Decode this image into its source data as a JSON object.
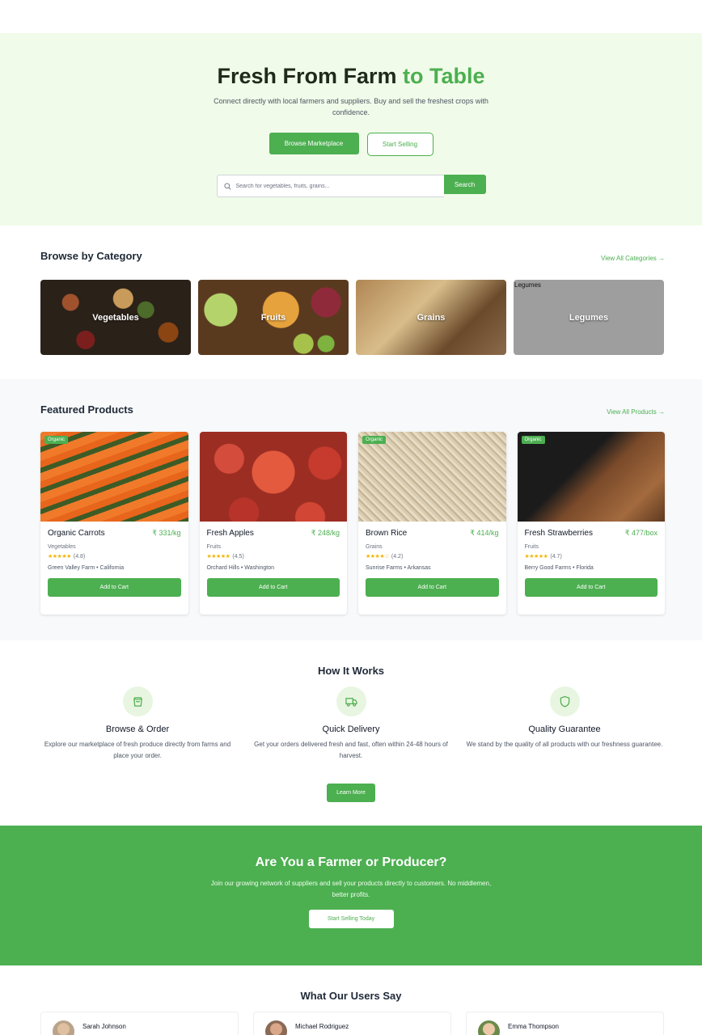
{
  "hero": {
    "title_main": "Fresh From Farm ",
    "title_accent": "to Table",
    "subtitle": "Connect directly with local farmers and suppliers. Buy and sell the freshest crops with confidence.",
    "browse_label": "Browse Marketplace",
    "sell_label": "Start Selling",
    "search_placeholder": "Search for vegetables, fruits, grains...",
    "search_button": "Search"
  },
  "categories": {
    "heading": "Browse by Category",
    "view_all": "View All Categories →",
    "items": [
      {
        "label": "Vegetables"
      },
      {
        "label": "Fruits"
      },
      {
        "label": "Grains"
      },
      {
        "label": "Legumes",
        "alt": "Legumes"
      }
    ]
  },
  "featured": {
    "heading": "Featured Products",
    "view_all": "View All Products →",
    "products": [
      {
        "badge": "Organic",
        "name": "Organic Carrots",
        "price": "₹ 331/kg",
        "category": "Vegetables",
        "stars": "★★★★★",
        "rating": "(4.8)",
        "farm": "Green Valley Farm • California",
        "button": "Add to Cart"
      },
      {
        "badge": "",
        "name": "Fresh Apples",
        "price": "₹ 248/kg",
        "category": "Fruits",
        "stars": "★★★★★",
        "rating": "(4.5)",
        "farm": "Orchard Hills • Washington",
        "button": "Add to Cart"
      },
      {
        "badge": "Organic",
        "name": "Brown Rice",
        "price": "₹ 414/kg",
        "category": "Grains",
        "stars": "★★★★☆",
        "rating": "(4.2)",
        "farm": "Sunrise Farms • Arkansas",
        "button": "Add to Cart"
      },
      {
        "badge": "Organic",
        "name": "Fresh Strawberries",
        "price": "₹ 477/box",
        "category": "Fruits",
        "stars": "★★★★★",
        "rating": "(4.7)",
        "farm": "Berry Good Farms • Florida",
        "button": "Add to Cart"
      }
    ]
  },
  "how": {
    "heading": "How It Works",
    "steps": [
      {
        "icon": "shopping-bag-icon",
        "title": "Browse & Order",
        "desc": "Explore our marketplace of fresh produce directly from farms and place your order."
      },
      {
        "icon": "truck-icon",
        "title": "Quick Delivery",
        "desc": "Get your orders delivered fresh and fast, often within 24-48 hours of harvest."
      },
      {
        "icon": "shield-icon",
        "title": "Quality Guarantee",
        "desc": "We stand by the quality of all products with our freshness guarantee."
      }
    ],
    "learn_more": "Learn More"
  },
  "cta": {
    "heading": "Are You a Farmer or Producer?",
    "text": "Join our growing network of suppliers and sell your products directly to customers. No middlemen, better profits.",
    "button": "Start Selling Today"
  },
  "testimonials": {
    "heading": "What Our Users Say",
    "users": [
      {
        "name": "Sarah Johnson"
      },
      {
        "name": "Michael Rodriguez"
      },
      {
        "name": "Emma Thompson"
      }
    ]
  },
  "colors": {
    "accent": "#4caf50",
    "hero_bg": "#f1fbe9",
    "section_alt_bg": "#f7f9fb"
  }
}
